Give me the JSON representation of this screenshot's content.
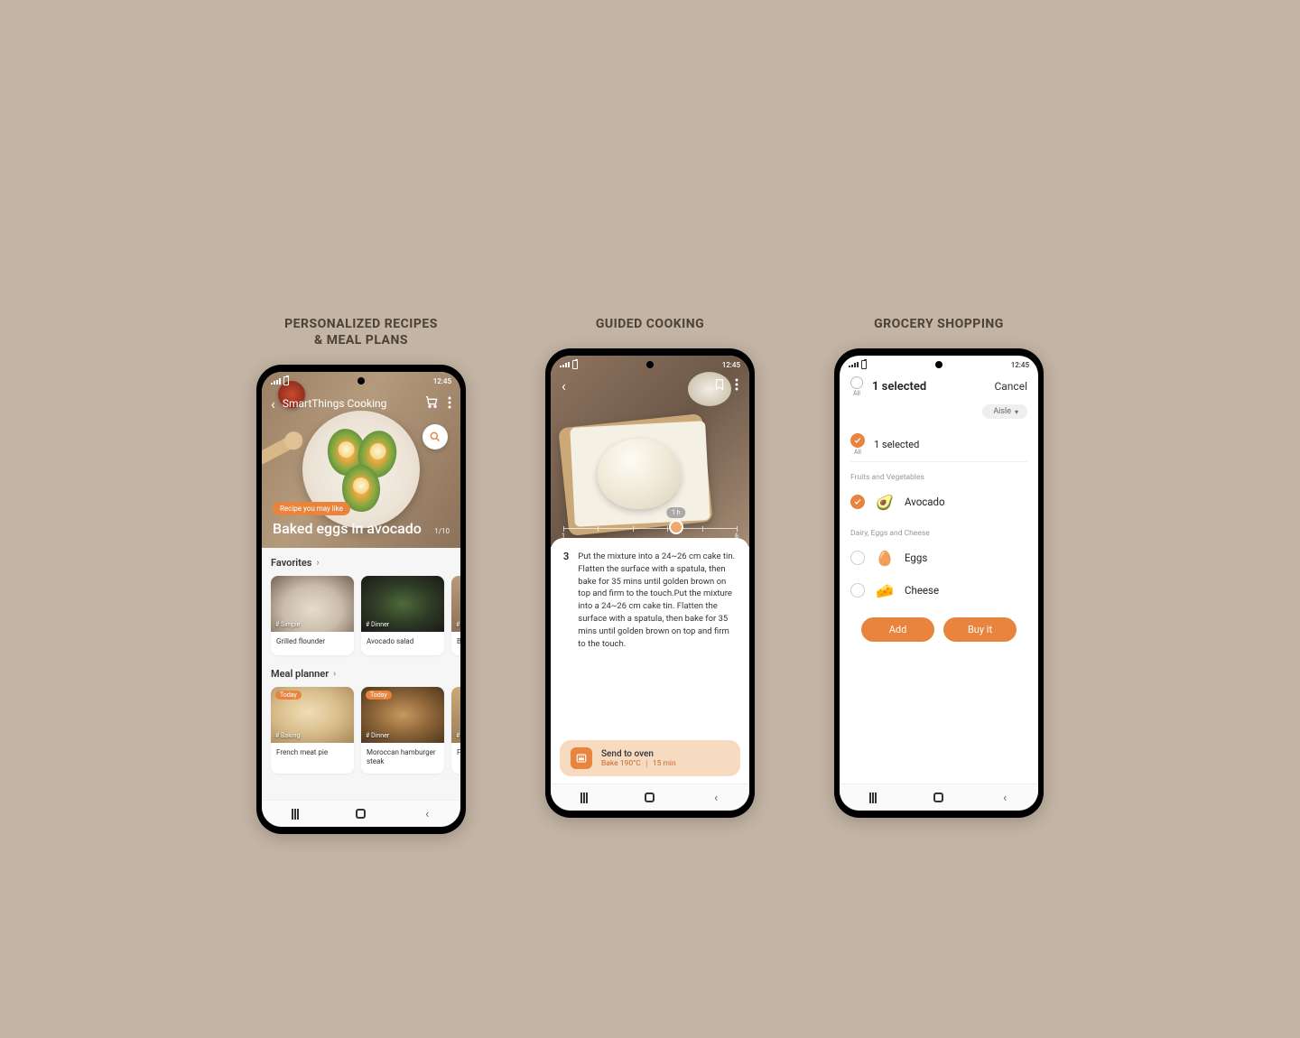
{
  "status_bar": {
    "time": "12:45"
  },
  "columns": {
    "recipes": {
      "title": "PERSONALIZED RECIPES\n& MEAL PLANS"
    },
    "cooking": {
      "title": "GUIDED COOKING"
    },
    "grocery": {
      "title": "GROCERY SHOPPING"
    }
  },
  "phone1": {
    "app_title": "SmartThings Cooking",
    "hero": {
      "chip": "Recipe you may like",
      "recipe_title": "Baked eggs in avocado",
      "counter": "1/10"
    },
    "sections": {
      "favorites": {
        "header": "Favorites",
        "cards": [
          {
            "tag": "# Simple",
            "label": "Grilled flounder"
          },
          {
            "tag": "# Dinner",
            "label": "Avocado salad"
          },
          {
            "tag": "# B",
            "label": "Bac"
          }
        ]
      },
      "meal_planner": {
        "header": "Meal planner",
        "cards": [
          {
            "today": "Today",
            "tag": "# Baking",
            "label": "French meat pie"
          },
          {
            "today": "Today",
            "tag": "# Dinner",
            "label": "Moroccan hamburger steak"
          },
          {
            "tag": "# B",
            "label": "Fren"
          }
        ]
      }
    }
  },
  "phone2": {
    "ruler": {
      "start": "1",
      "end": "6",
      "badge": "1 h"
    },
    "step": {
      "number": "3",
      "text": "Put the mixture into a 24~26 cm cake tin. Flatten the surface with a spatula, then bake for 35 mins until golden brown on top and firm to the touch.Put the mixture into a 24~26 cm cake tin. Flatten the surface with a spatula, then bake for 35 mins until golden brown on top and firm to the touch."
    },
    "send": {
      "title": "Send to oven",
      "temp": "Bake 190°C",
      "time": "15 min"
    }
  },
  "phone3": {
    "topbar": {
      "all_label": "All",
      "selected": "1 selected",
      "cancel": "Cancel"
    },
    "aisle": "Aisle",
    "summary": {
      "all_label": "All",
      "selected": "1 selected"
    },
    "categories": [
      {
        "name": "Fruits and Vegetables",
        "items": [
          {
            "name": "Avocado",
            "checked": true,
            "emoji": "🥑"
          }
        ]
      },
      {
        "name": "Dairy, Eggs and Cheese",
        "items": [
          {
            "name": "Eggs",
            "checked": false,
            "emoji": "🥚"
          },
          {
            "name": "Cheese",
            "checked": false,
            "emoji": "🧀"
          }
        ]
      }
    ],
    "buttons": {
      "add": "Add",
      "buy": "Buy it"
    }
  }
}
